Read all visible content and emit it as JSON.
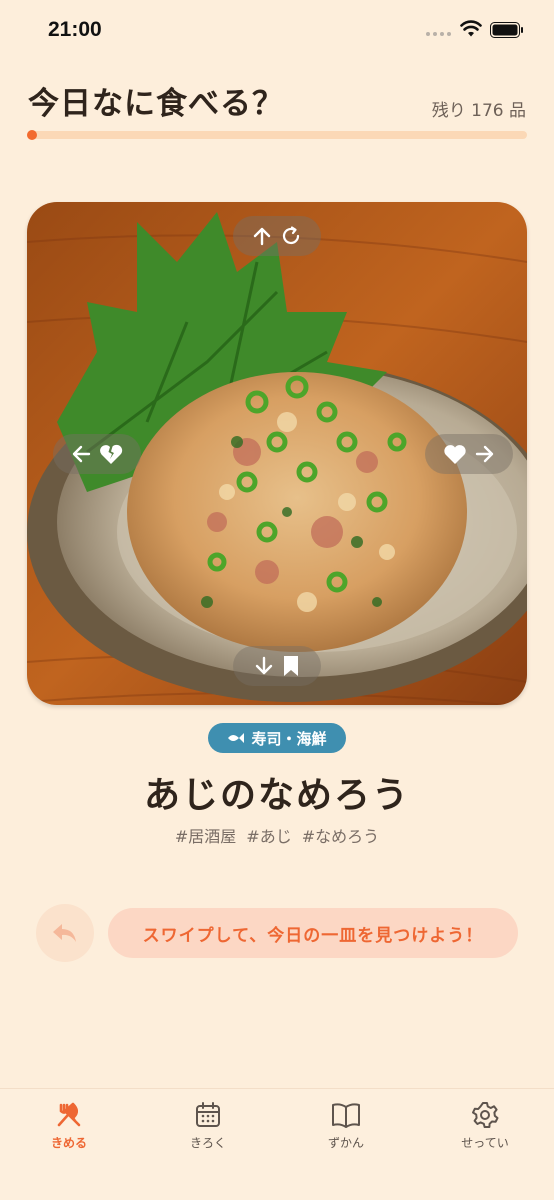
{
  "status_bar": {
    "time": "21:00"
  },
  "header": {
    "title": "今日なに食べる？",
    "remaining": "残り 176 品",
    "progress": 0.01,
    "progress_color": "#f26a2e"
  },
  "card": {
    "image": "aji-namerou-photo",
    "hint_up_icons": [
      "arrow-up-icon",
      "refresh-icon"
    ],
    "hint_down_icons": [
      "arrow-down-icon",
      "bookmark-icon"
    ],
    "hint_left_icons": [
      "arrow-left-icon",
      "broken-heart-icon"
    ],
    "hint_right_icons": [
      "heart-icon",
      "arrow-right-icon"
    ]
  },
  "dish": {
    "category": "寿司・海鮮",
    "category_icon": "fish-icon",
    "category_color": "#3f8fb0",
    "name": "あじのなめろう",
    "tags": [
      "#居酒屋",
      "#あじ",
      "#なめろう"
    ]
  },
  "actions": {
    "undo_icon": "undo-arrow-icon",
    "hint_text": "スワイプして、今日の一皿を見つけよう！"
  },
  "tab_bar": {
    "tabs": [
      {
        "label": "きめる",
        "icon": "fork-knife-icon",
        "active": true
      },
      {
        "label": "きろく",
        "icon": "calendar-icon",
        "active": false
      },
      {
        "label": "ずかん",
        "icon": "book-icon",
        "active": false
      },
      {
        "label": "せってい",
        "icon": "gear-icon",
        "active": false
      }
    ],
    "accent_color": "#ee6733"
  }
}
